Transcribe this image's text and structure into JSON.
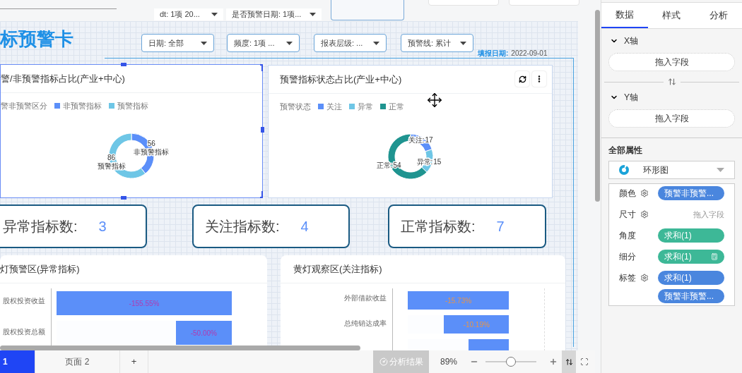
{
  "top_filters": [
    {
      "label": "dt: 1项 20..."
    },
    {
      "label": "是否预警日期: 1项..."
    }
  ],
  "title": "标预警卡",
  "filters": [
    {
      "label": "日期: 全部"
    },
    {
      "label": "频度: 1项 ..."
    },
    {
      "label": "报表层级: ..."
    },
    {
      "label": "预警线: 累计"
    }
  ],
  "report_date": {
    "label": "填报日期:",
    "value": "2022-09-01"
  },
  "donut_cards": [
    {
      "title": "警/非预警指标占比(产业+中心)",
      "selected": true,
      "legend_title": "警非预警区分",
      "chart_data": {
        "type": "donut",
        "categories": [
          "非预警指标",
          "预警指标"
        ],
        "values": [
          56,
          86
        ],
        "colors": [
          "#5b8ff9",
          "#6ec6e6"
        ],
        "data_labels": true
      }
    },
    {
      "title": "预警指标状态占比(产业+中心)",
      "selected": false,
      "legend_title": "预警状态",
      "label_separator": ":",
      "chart_data": {
        "type": "donut",
        "categories": [
          "关注",
          "异常",
          "正常"
        ],
        "values": [
          17,
          15,
          54
        ],
        "colors": [
          "#5b8ff9",
          "#6ec6e6",
          "#1f9490"
        ],
        "data_labels": true
      }
    }
  ],
  "metrics": [
    {
      "label": "异常指标数:",
      "value": "3"
    },
    {
      "label": "关注指标数:",
      "value": "4"
    },
    {
      "label": "正常指标数:",
      "value": "7"
    }
  ],
  "bar_cards": [
    {
      "title": "灯预警区(异常指标)",
      "bars": [
        {
          "name": "股权投资收益",
          "value": "-155.55%",
          "level": 1
        },
        {
          "name": "股权投资总额",
          "value": "-50.00%",
          "level": 0.32
        }
      ]
    },
    {
      "title": "黄灯观察区(关注指标)",
      "bars": [
        {
          "name": "外部借款收益",
          "value": "-15.73%",
          "level": 1
        },
        {
          "name": "总纯销达成率",
          "value": "-10.19%",
          "level": 0.64
        },
        {
          "level": 0.4
        }
      ]
    }
  ],
  "page_tabs": [
    {
      "label": "1",
      "selected": true
    },
    {
      "label": "页面 2",
      "selected": false
    }
  ],
  "add_page": "+",
  "analysis_button": "分析结果",
  "zoom": {
    "value": "89%",
    "level": 0.5
  },
  "panel": {
    "tabs": [
      {
        "label": "数据",
        "selected": true
      },
      {
        "label": "样式",
        "selected": false
      },
      {
        "label": "分析",
        "selected": false
      }
    ],
    "axes": [
      {
        "label": "X轴",
        "expanded": true,
        "drop": "拖入字段"
      },
      {
        "label": "Y轴",
        "expanded": true,
        "drop": "拖入字段"
      }
    ],
    "all_props": "全部属性",
    "chart_type": "环形图",
    "props": [
      {
        "label": "颜色",
        "gear": true,
        "pills": [
          {
            "text": "预警非预警...",
            "kind": "dimension"
          }
        ]
      },
      {
        "label": "尺寸",
        "gear": true,
        "placeholder": "拖入字段"
      },
      {
        "label": "角度",
        "gear": false,
        "pills": [
          {
            "text": "求和(1)",
            "kind": "measure"
          }
        ]
      },
      {
        "label": "细分",
        "gear": false,
        "pills": [
          {
            "text": "求和(1)",
            "kind": "measure",
            "calc": true
          }
        ]
      },
      {
        "label": "标签",
        "gear": true,
        "pills": [
          {
            "text": "求和(1)",
            "kind": "dimension"
          },
          {
            "text": "预警非预警...",
            "kind": "dimension"
          }
        ]
      }
    ]
  }
}
